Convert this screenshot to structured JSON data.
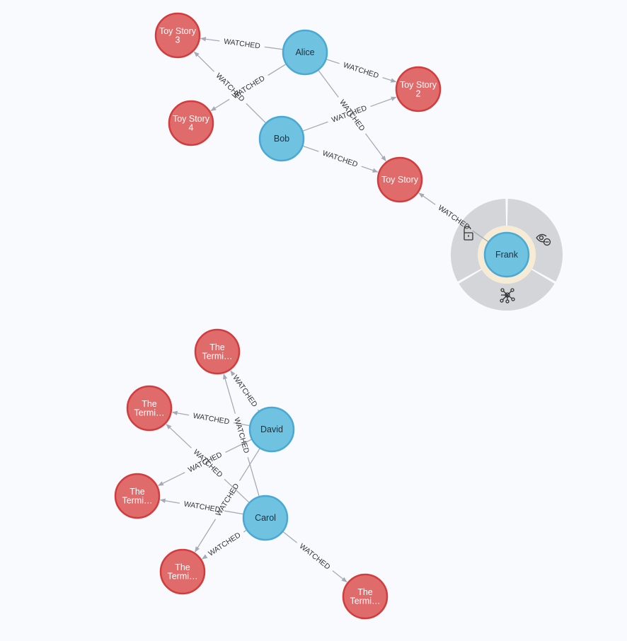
{
  "graph": {
    "colors": {
      "background": "#f8fafe",
      "person_fill": "#6fc2e0",
      "person_stroke": "#4aa9d4",
      "movie_fill": "#e06b6b",
      "movie_stroke": "#d23c3c",
      "edge": "#a5abb6",
      "edge_label": "#333333",
      "ring_menu": "#d4d5d8",
      "selection_halo": "#f6ecd6"
    },
    "relationship_type": "WATCHED",
    "nodes": [
      {
        "id": "alice",
        "label": "Alice",
        "kind": "person"
      },
      {
        "id": "bob",
        "label": "Bob",
        "kind": "person"
      },
      {
        "id": "frank",
        "label": "Frank",
        "kind": "person",
        "selected": true
      },
      {
        "id": "david",
        "label": "David",
        "kind": "person"
      },
      {
        "id": "carol",
        "label": "Carol",
        "kind": "person"
      },
      {
        "id": "ts3",
        "label": [
          "Toy Story",
          "3"
        ],
        "kind": "movie"
      },
      {
        "id": "ts4",
        "label": [
          "Toy Story",
          "4"
        ],
        "kind": "movie"
      },
      {
        "id": "ts2",
        "label": [
          "Toy Story",
          "2"
        ],
        "kind": "movie"
      },
      {
        "id": "ts1",
        "label": [
          "Toy Story"
        ],
        "kind": "movie"
      },
      {
        "id": "t1",
        "label": [
          "The",
          "Termi…"
        ],
        "kind": "movie"
      },
      {
        "id": "t2",
        "label": [
          "The",
          "Termi…"
        ],
        "kind": "movie"
      },
      {
        "id": "t3",
        "label": [
          "The",
          "Termi…"
        ],
        "kind": "movie"
      },
      {
        "id": "t4",
        "label": [
          "The",
          "Termi…"
        ],
        "kind": "movie"
      },
      {
        "id": "t5",
        "label": [
          "The",
          "Termi…"
        ],
        "kind": "movie"
      }
    ],
    "edges": [
      {
        "from": "alice",
        "to": "ts3",
        "label": "WATCHED"
      },
      {
        "from": "alice",
        "to": "ts4",
        "label": "WATCHED"
      },
      {
        "from": "alice",
        "to": "ts2",
        "label": "WATCHED"
      },
      {
        "from": "alice",
        "to": "ts1",
        "label": "WATCHED"
      },
      {
        "from": "bob",
        "to": "ts3",
        "label": "WATCHED"
      },
      {
        "from": "bob",
        "to": "ts2",
        "label": "WATCHED"
      },
      {
        "from": "bob",
        "to": "ts1",
        "label": "WATCHED"
      },
      {
        "from": "frank",
        "to": "ts1",
        "label": "WATCHED"
      },
      {
        "from": "david",
        "to": "t1",
        "label": "WATCHED"
      },
      {
        "from": "david",
        "to": "t2",
        "label": "WATCHED"
      },
      {
        "from": "david",
        "to": "t3",
        "label": "WATCHED"
      },
      {
        "from": "david",
        "to": "t4",
        "label": "WATCHED"
      },
      {
        "from": "carol",
        "to": "t1",
        "label": "WATCHED"
      },
      {
        "from": "carol",
        "to": "t2",
        "label": "WATCHED"
      },
      {
        "from": "carol",
        "to": "t3",
        "label": "WATCHED"
      },
      {
        "from": "carol",
        "to": "t4",
        "label": "WATCHED"
      },
      {
        "from": "carol",
        "to": "t5",
        "label": "WATCHED"
      }
    ],
    "context_menu": {
      "target": "frank",
      "items": [
        {
          "action": "unlock",
          "icon": "unlock-icon"
        },
        {
          "action": "hide",
          "icon": "eye-hide-icon"
        },
        {
          "action": "expand",
          "icon": "network-expand-icon"
        }
      ]
    }
  }
}
